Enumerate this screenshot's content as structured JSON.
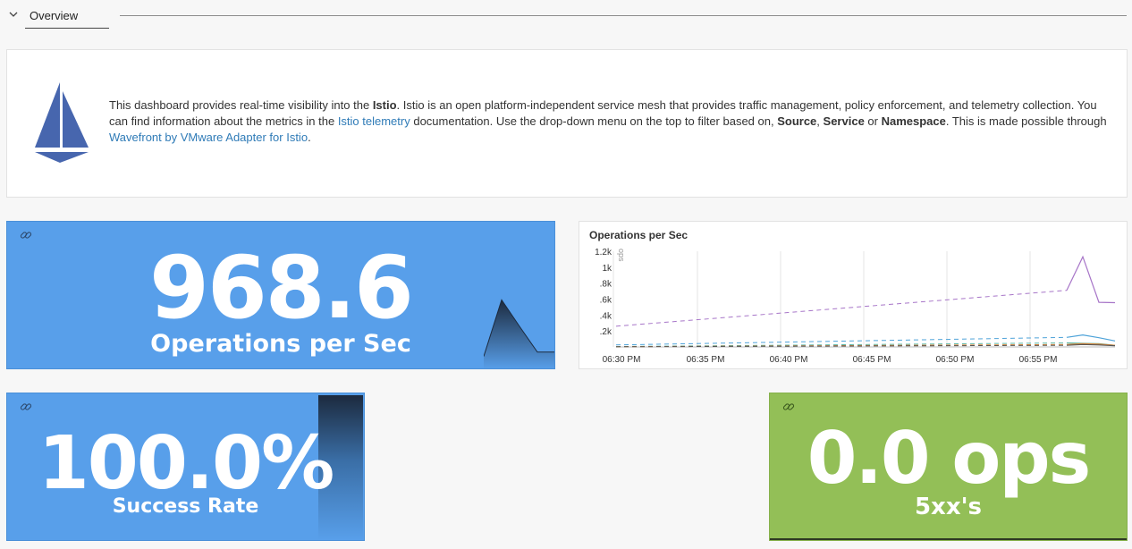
{
  "section": {
    "title": "Overview"
  },
  "intro": {
    "p1": "This dashboard provides real-time visibility into the ",
    "b1": "Istio",
    "p2": ". Istio is an open platform-independent service mesh that provides traffic management, policy enforcement, and telemetry collection. You can find information about the metrics in the ",
    "link1": "Istio telemetry",
    "p3": " documentation. Use the drop-down menu on the top to filter based on, ",
    "b2": "Source",
    "p4": ", ",
    "b3": "Service",
    "p5": " or ",
    "b4": "Namespace",
    "p6": ". This is made possible through ",
    "link2": "Wavefront by VMware Adapter for Istio",
    "p7": "."
  },
  "tiles": {
    "ops": {
      "value": "968.6",
      "label": "Operations per Sec"
    },
    "success": {
      "value": "100.0%",
      "label": "Success Rate"
    },
    "errors": {
      "value": "0.0 ops",
      "label": "5xx's"
    }
  },
  "colors": {
    "tile_blue": "#589fea",
    "tile_green": "#93bf57",
    "link": "#2f7bb7",
    "series_purple": "#a775c8",
    "series_blue": "#4ea3d9",
    "series_teal": "#5bb8a6",
    "series_orange": "#e0873a",
    "series_dark": "#555555"
  },
  "chart_data": {
    "type": "line",
    "title": "Operations per Sec",
    "ylabel": "ops",
    "xlabel": "",
    "x_ticks": [
      "06:30 PM",
      "06:35 PM",
      "06:40 PM",
      "06:45 PM",
      "06:50 PM",
      "06:55 PM"
    ],
    "y_ticks": [
      "1.2k",
      "1k",
      ".8k",
      ".6k",
      ".4k",
      ".2k"
    ],
    "xlim": [
      0,
      31
    ],
    "ylim": [
      0,
      1200
    ],
    "grid": true,
    "series": [
      {
        "color": "#a775c8",
        "points": [
          [
            0,
            260
          ],
          [
            28,
            710
          ],
          [
            29,
            1130
          ],
          [
            30,
            560
          ],
          [
            31,
            555
          ]
        ]
      },
      {
        "color": "#4ea3d9",
        "points": [
          [
            0,
            25
          ],
          [
            28,
            120
          ],
          [
            29,
            150
          ],
          [
            30,
            115
          ],
          [
            31,
            75
          ]
        ]
      },
      {
        "color": "#5bb8a6",
        "points": [
          [
            0,
            5
          ],
          [
            28,
            50
          ],
          [
            29,
            45
          ],
          [
            30,
            40
          ],
          [
            31,
            20
          ]
        ]
      },
      {
        "color": "#e0873a",
        "points": [
          [
            0,
            3
          ],
          [
            28,
            30
          ],
          [
            29,
            40
          ],
          [
            30,
            35
          ],
          [
            31,
            20
          ]
        ]
      },
      {
        "color": "#555555",
        "points": [
          [
            0,
            2
          ],
          [
            28,
            20
          ],
          [
            29,
            30
          ],
          [
            30,
            25
          ],
          [
            31,
            15
          ]
        ]
      }
    ],
    "sparklines": {
      "ops": [
        180,
        970,
        600,
        240,
        240
      ],
      "success": [
        100
      ]
    }
  }
}
